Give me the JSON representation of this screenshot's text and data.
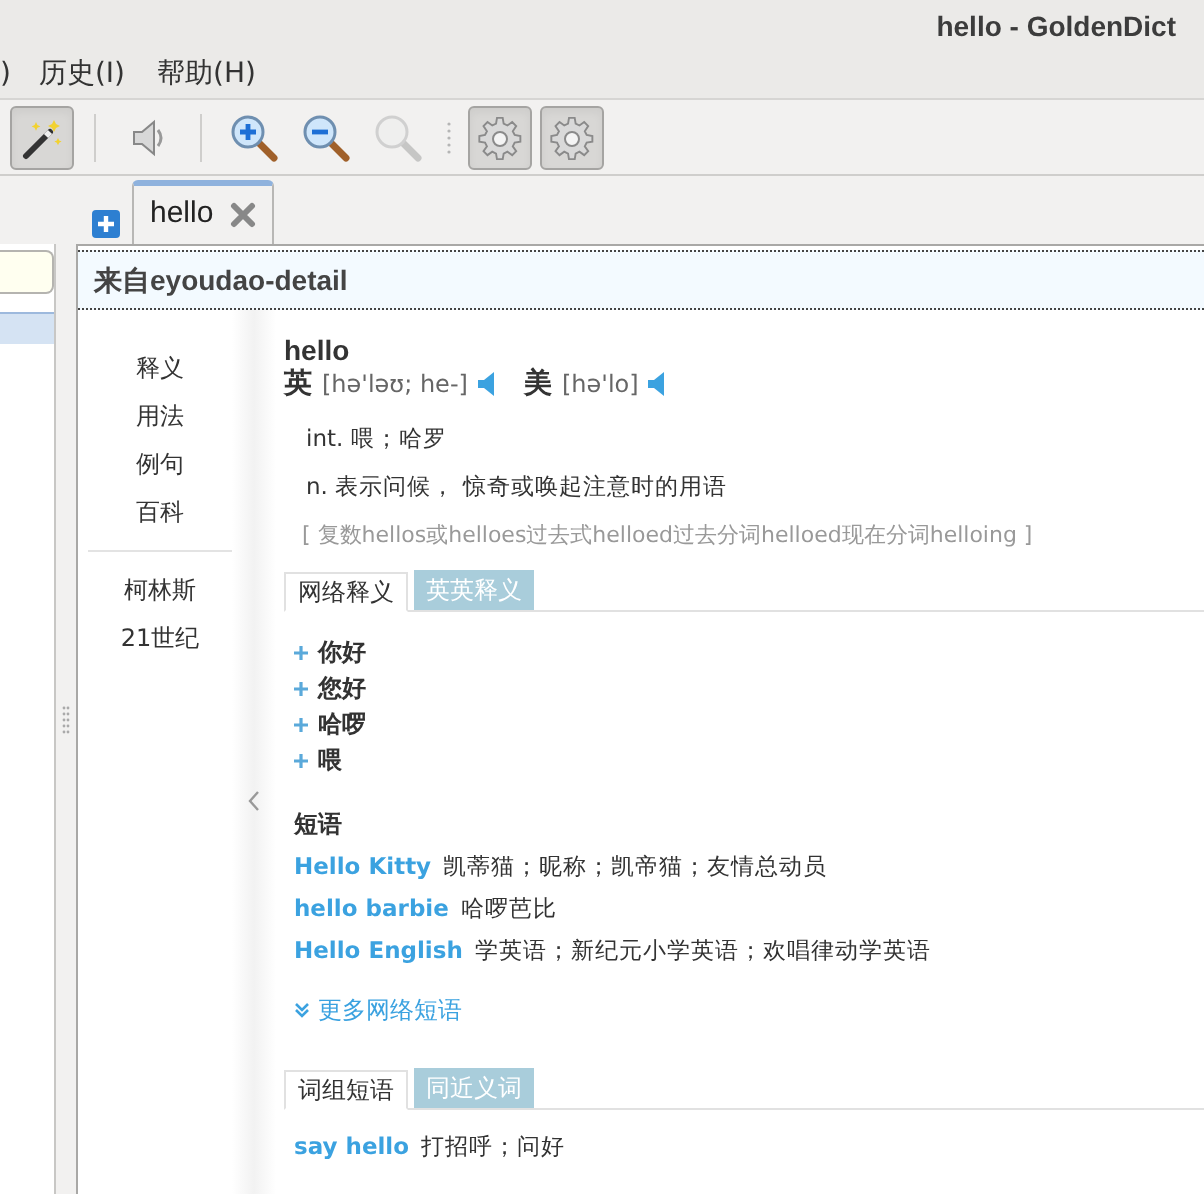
{
  "window": {
    "title": "hello - GoldenDict"
  },
  "menu": [
    {
      "label": ")"
    },
    {
      "label": "历史(I)"
    },
    {
      "label": "帮助(H)"
    }
  ],
  "toolbar": [
    {
      "kind": "wand",
      "checked": true,
      "disabled": false
    },
    {
      "kind": "separator"
    },
    {
      "kind": "speaker",
      "disabled": false
    },
    {
      "kind": "separator"
    },
    {
      "kind": "zoom-in",
      "disabled": false
    },
    {
      "kind": "zoom-out",
      "disabled": false
    },
    {
      "kind": "zoom-reset",
      "disabled": true
    },
    {
      "kind": "grip"
    },
    {
      "kind": "gear",
      "checked": true,
      "disabled": false
    },
    {
      "kind": "gear",
      "checked": true,
      "disabled": false
    }
  ],
  "tabs": [
    {
      "label": "hello",
      "selected": true
    }
  ],
  "article": {
    "source": "来自eyoudao-detail",
    "nav_groups": [
      {
        "items": [
          "释义",
          "用法",
          "例句",
          "百科"
        ]
      },
      {
        "items": [
          "柯林斯",
          "21世纪"
        ]
      }
    ],
    "headword": "hello",
    "pronunciations": [
      {
        "region": "英",
        "phonetic": "[hə'ləʊ; he-]"
      },
      {
        "region": "美",
        "phonetic": "[hə'lo]"
      }
    ],
    "definitions": [
      "int. 喂；哈罗",
      "n. 表示问候， 惊奇或唤起注意时的用语"
    ],
    "forms": "[ 复数hellos或helloes过去式helloed过去分词helloed现在分词helloing ]",
    "web_tabs": [
      {
        "label": "网络释义",
        "selected": true
      },
      {
        "label": "英英释义",
        "selected": false
      }
    ],
    "web_meanings": [
      "你好",
      "您好",
      "哈啰",
      "喂"
    ],
    "phrases_title": "短语",
    "phrases": [
      {
        "term": "Hello Kitty",
        "meaning": "凯蒂猫；昵称；凯帝猫；友情总动员"
      },
      {
        "term": "hello barbie",
        "meaning": "哈啰芭比"
      },
      {
        "term": "Hello English",
        "meaning": "学英语；新纪元小学英语；欢唱律动学英语"
      }
    ],
    "more_link": "更多网络短语",
    "phrase_tabs": [
      {
        "label": "词组短语",
        "selected": true
      },
      {
        "label": "同近义词",
        "selected": false
      }
    ],
    "word_phrases": [
      {
        "term": "say hello",
        "meaning": "打招呼；问好"
      }
    ]
  }
}
